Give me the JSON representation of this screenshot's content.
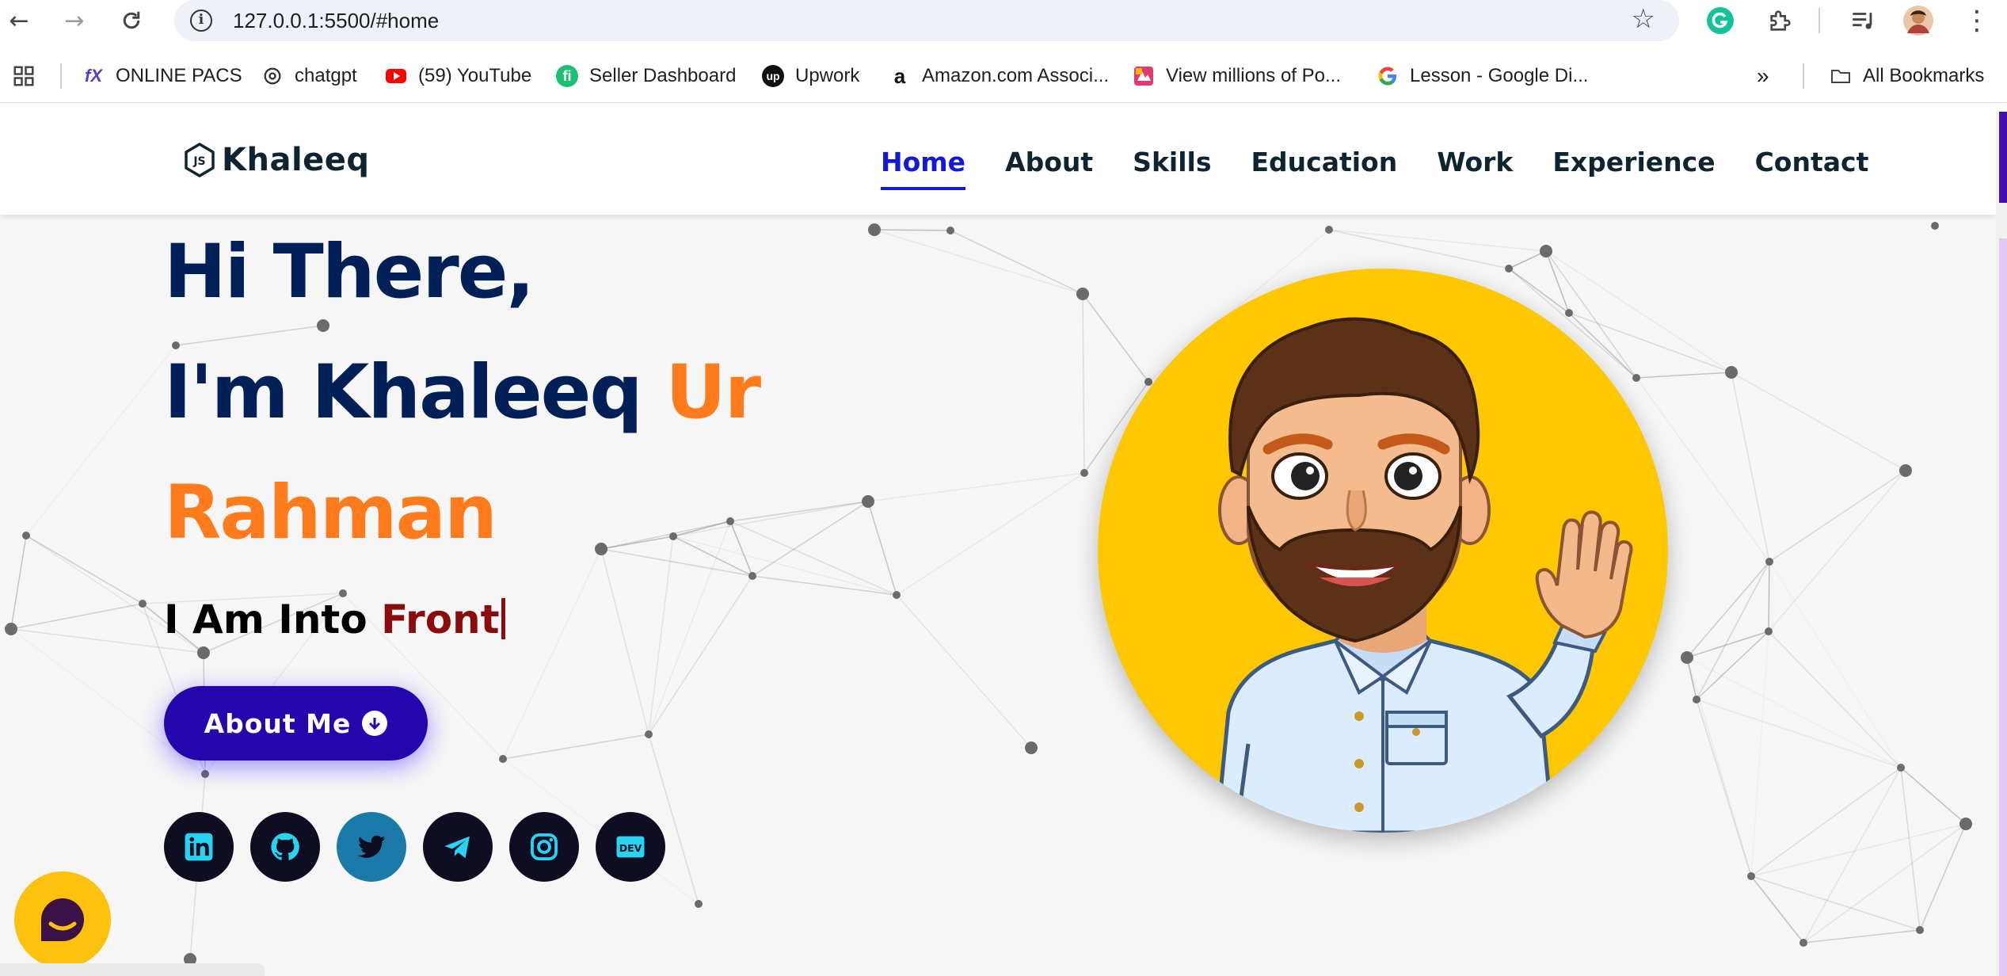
{
  "browser": {
    "url": "127.0.0.1:5500/#home",
    "bookmarks": [
      {
        "label": "ONLINE PACS",
        "icon": "pacs-icon"
      },
      {
        "label": "chatgpt",
        "icon": "chatgpt-icon"
      },
      {
        "label": "(59) YouTube",
        "icon": "youtube-icon"
      },
      {
        "label": "Seller Dashboard",
        "icon": "fiverr-icon"
      },
      {
        "label": "Upwork",
        "icon": "upwork-icon"
      },
      {
        "label": "Amazon.com Associ...",
        "icon": "amazon-icon"
      },
      {
        "label": "View millions of Po...",
        "icon": "photos-icon"
      },
      {
        "label": "Lesson - Google Di...",
        "icon": "google-icon"
      }
    ],
    "all_bookmarks_label": "All Bookmarks"
  },
  "site": {
    "brand": "Khaleeq",
    "nav": [
      {
        "label": "Home",
        "active": true
      },
      {
        "label": "About",
        "active": false
      },
      {
        "label": "Skills",
        "active": false
      },
      {
        "label": "Education",
        "active": false
      },
      {
        "label": "Work",
        "active": false
      },
      {
        "label": "Experience",
        "active": false
      },
      {
        "label": "Contact",
        "active": false
      }
    ]
  },
  "hero": {
    "greeting": "Hi There,",
    "intro": "I'm Khaleeq",
    "name_first": "Ur",
    "name_last": "Rahman",
    "typed_prefix": "I Am Into",
    "typed_word": "Front",
    "button_label": "About Me",
    "socials": [
      "linkedin-icon",
      "github-icon",
      "twitter-icon",
      "telegram-icon",
      "instagram-icon",
      "dev-icon"
    ]
  },
  "colors": {
    "heading": "#002057",
    "accent_orange": "#ff7b1c",
    "nav_active": "#1319d8",
    "button": "#2506ad",
    "avatar_bg": "#ffc700",
    "typed_word": "#8b0c0c"
  }
}
